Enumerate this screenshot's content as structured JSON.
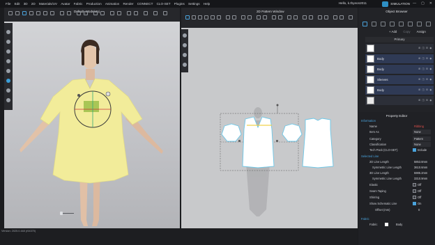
{
  "menu": [
    "File",
    "Edit",
    "3D",
    "2D",
    "Materials/UV",
    "Avatar",
    "Fabric",
    "Production",
    "Animation",
    "Render",
    "CONNECT",
    "CLO-SET",
    "Plugins",
    "Settings",
    "Help"
  ],
  "user": {
    "greeting": "Hello, k.thyeon2011"
  },
  "simulation": {
    "label": "SIMULATION"
  },
  "window_buttons": [
    "—",
    "▢",
    "✕"
  ],
  "view3d": {
    "title": "Default_Model.zpj"
  },
  "view2d": {
    "title": "2D Pattern Window"
  },
  "status": {
    "version": "Version: 2025.0.448 (r54370)"
  },
  "object_browser": {
    "title": "Object Browser",
    "actions": [
      "+ Add",
      "Copy",
      "Assign"
    ],
    "primary_header": "Primary",
    "rows": [
      {
        "name": "",
        "selected": false
      },
      {
        "name": "Body",
        "selected": true
      },
      {
        "name": "Body",
        "selected": true
      },
      {
        "name": "Sleeves",
        "selected": true
      },
      {
        "name": "Body",
        "selected": true
      },
      {
        "name": "",
        "selected": false
      }
    ],
    "row_icons": "⊞ ◫ ⊟ ◉"
  },
  "property_editor": {
    "title": "Property Editor",
    "information_header": "Information",
    "info_rows": [
      {
        "key": "Name",
        "value": "Ribbing",
        "red": true
      },
      {
        "key": "Item As",
        "value": "None"
      },
      {
        "key": "Category",
        "value": "Pattern"
      },
      {
        "key": "Classification",
        "value": "None"
      },
      {
        "key": "Tech Pack (CLO-SET)",
        "check": true,
        "value": "Include"
      }
    ],
    "selected_line_header": "Selected Line",
    "line_rows": [
      {
        "key": "2D Line Length",
        "value": "5853.8mm"
      },
      {
        "key": "Symmetric Line Length",
        "value": "3610.6mm"
      },
      {
        "key": "3D Line Length",
        "value": "5985.2mm"
      },
      {
        "key": "Symmetric Line Length",
        "value": "3310.9mm"
      },
      {
        "key": "Elastic",
        "check": false,
        "value": "Off"
      },
      {
        "key": "Seam Taping",
        "check": false,
        "value": "Off"
      },
      {
        "key": "Shirring",
        "check": false,
        "value": "Off"
      },
      {
        "key": "Show Schematic Line",
        "check": true,
        "value": "On"
      },
      {
        "key": "Offset (mm)",
        "value": "0"
      }
    ],
    "fabric_header": "Fabric",
    "fabric_key": "Fabric",
    "fabric_value": "Body"
  },
  "colors": {
    "accent": "#4aa3dc",
    "garment": "#f2ec9a",
    "highlight_red": "#e0504b"
  }
}
